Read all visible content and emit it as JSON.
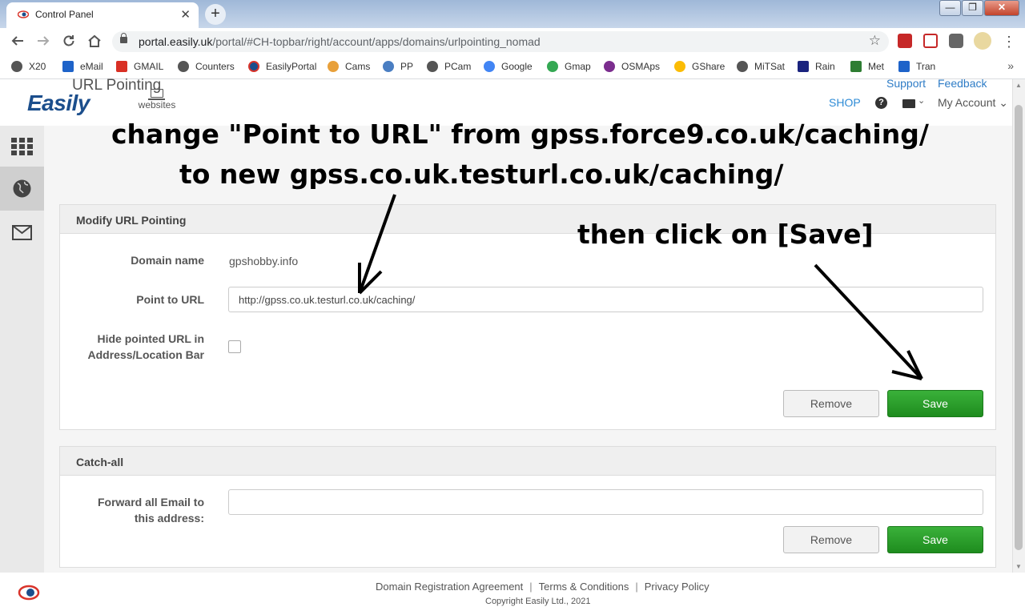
{
  "browser": {
    "tab_title": "Control Panel",
    "tab_close": "✕",
    "new_tab": "+",
    "window_min": "—",
    "window_max": "❐",
    "window_close": "✕",
    "url_host": "portal.easily.uk",
    "url_path": "/portal/#CH-topbar/right/account/apps/domains/urlpointing_nomad",
    "bookmarks": [
      "X20",
      "eMail",
      "GMAIL",
      "Counters",
      "EasilyPortal",
      "Cams",
      "PP",
      "PCam",
      "Google",
      "Gmap",
      "OSMAps",
      "GShare",
      "MiTSat",
      "Rain",
      "Met",
      "Tran"
    ],
    "bookmarks_more": "»"
  },
  "header": {
    "logo": "Easily",
    "websites_label": "websites",
    "shop": "SHOP",
    "help": "?",
    "mail_chevron": "⌄",
    "my_account": "My Account ⌄"
  },
  "page": {
    "title": "URL Pointing",
    "support": "Support",
    "feedback": "Feedback"
  },
  "modify_panel": {
    "heading": "Modify URL Pointing",
    "domain_label": "Domain name",
    "domain_value": "gpshobby.info",
    "point_label": "Point to URL",
    "point_value": "http://gpss.co.uk.testurl.co.uk/caching/",
    "hide_label": "Hide pointed URL in Address/Location Bar",
    "hide_checked": false,
    "remove": "Remove",
    "save": "Save"
  },
  "catchall_panel": {
    "heading": "Catch-all",
    "forward_label": "Forward all Email to this address:",
    "forward_value": "",
    "remove": "Remove",
    "save": "Save"
  },
  "footer": {
    "link1": "Domain Registration Agreement",
    "link2": "Terms & Conditions",
    "link3": "Privacy Policy",
    "sep": "|",
    "copyright": "Copyright Easily Ltd., 2021"
  },
  "annotations": {
    "line1": "change \"Point to URL\" from gpss.force9.co.uk/caching/",
    "line2": "to new gpss.co.uk.testurl.co.uk/caching/",
    "line3": "then click on [Save]"
  },
  "colors": {
    "brand_blue": "#1b4e8c",
    "link_blue": "#2e7cc6",
    "save_green": "#1e8c1e",
    "logo_red": "#d9342b"
  }
}
